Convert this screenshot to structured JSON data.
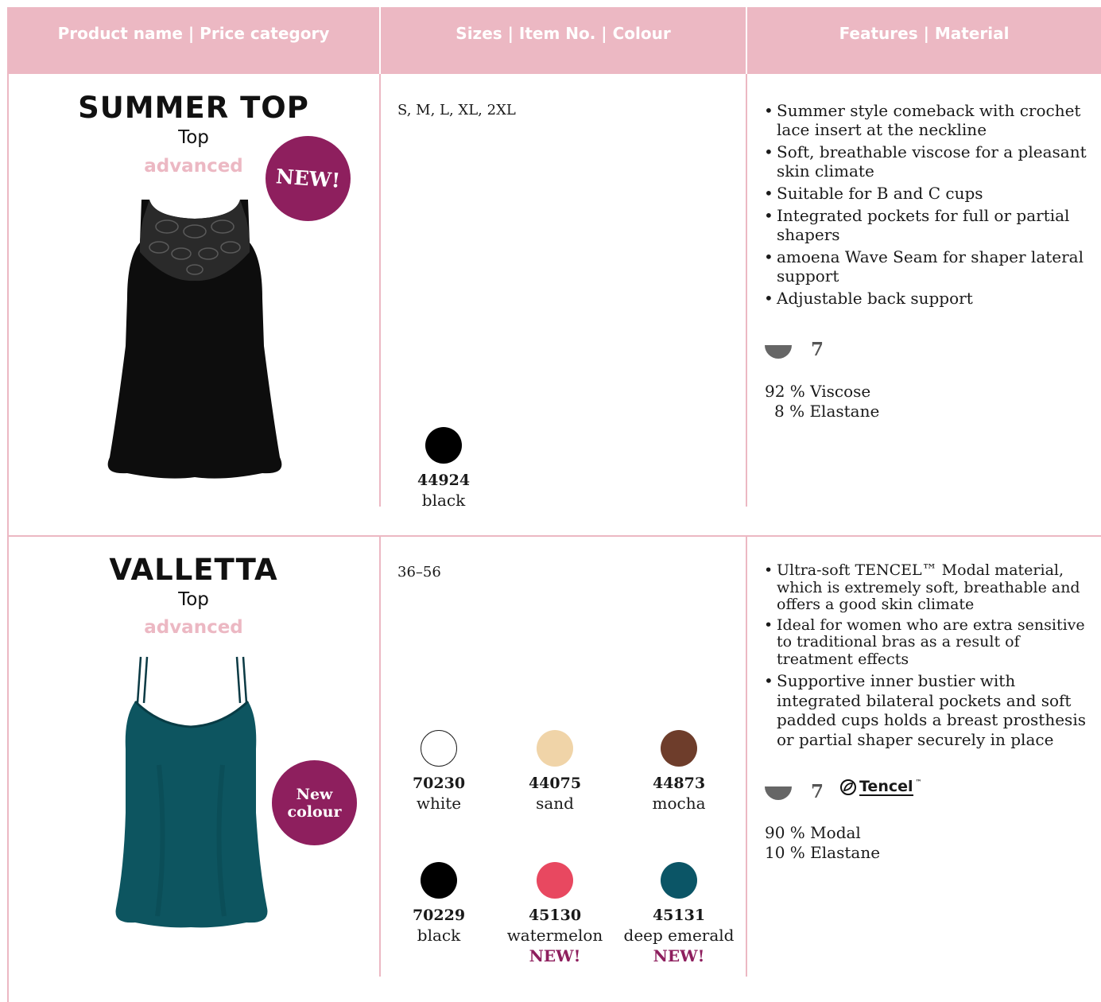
{
  "header": {
    "col1": "Product name | Price category",
    "col2": "Sizes | Item No. | Colour",
    "col3": "Features | Material",
    "color": "#ecb8c3"
  },
  "products": [
    {
      "name": "SUMMER TOP",
      "type": "Top",
      "category": "advanced",
      "badge": "NEW!",
      "image": "black-lace-camisole",
      "sizes": "S, M, L, XL, 2XL",
      "colours": [
        {
          "code": "44924",
          "name": "black",
          "color": "#000000",
          "new": ""
        }
      ],
      "features": [
        "Summer style comeback with crochet lace insert at the neckline",
        "Soft, breathable viscose for a pleasant skin climate",
        "Suitable for B and C cups",
        "Integrated pockets for full or partial shapers",
        "amoena Wave Seam for shaper lateral support",
        "Adjustable back support"
      ],
      "cup_icon": "shaper-cup-icon",
      "cup_number": "7",
      "material": [
        "92 % Viscose",
        "8 % Elastane"
      ]
    },
    {
      "name": "VALLETTA",
      "type": "Top",
      "category": "advanced",
      "badge_line1": "New",
      "badge_line2": "colour",
      "image": "teal-strappy-camisole",
      "sizes": "36–56",
      "colours": [
        {
          "code": "70230",
          "name": "white",
          "color": "#ffffff",
          "new": ""
        },
        {
          "code": "44075",
          "name": "sand",
          "color": "#f0d4a8",
          "new": ""
        },
        {
          "code": "44873",
          "name": "mocha",
          "color": "#6e3d2b",
          "new": ""
        },
        {
          "code": "70229",
          "name": "black",
          "color": "#000000",
          "new": ""
        },
        {
          "code": "45130",
          "name": "watermelon",
          "color": "#e84860",
          "new": "NEW!"
        },
        {
          "code": "45131",
          "name": "deep emerald",
          "color": "#0b5566",
          "new": "NEW!"
        }
      ],
      "features": [
        "Ultra-soft TENCEL™ Modal material, which is extremely soft, breathable and offers a good skin climate",
        "Ideal for women who are extra sensitive to traditional bras as a result of treatment effects",
        "Supportive inner bustier with integrated bilateral pockets and soft padded cups holds a breast prosthesis or partial shaper securely in place"
      ],
      "cup_icon": "shaper-cup-icon",
      "cup_number": "7",
      "logo_text": "Tencel",
      "logo_mark": "™",
      "material": [
        "90 % Modal",
        "10 % Elastane"
      ]
    }
  ]
}
